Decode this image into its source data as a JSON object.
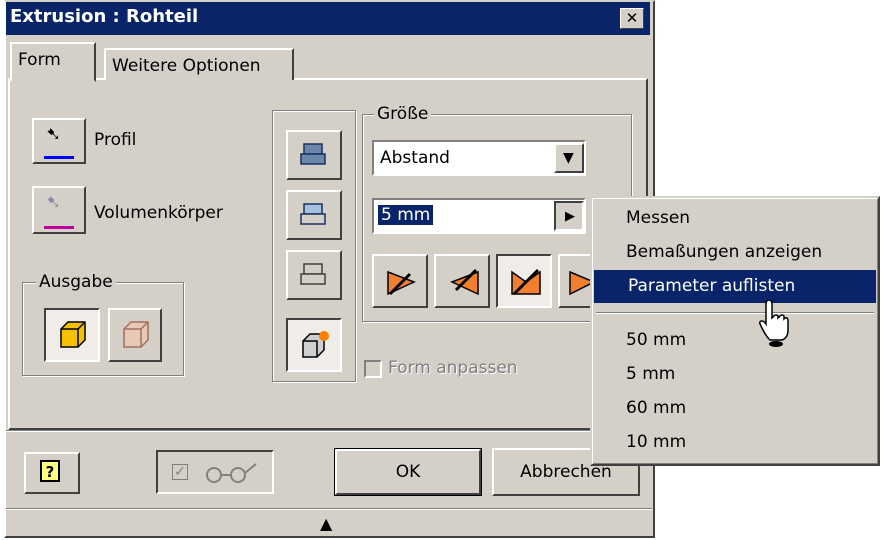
{
  "dialog": {
    "title": "Extrusion : Rohteil",
    "close_glyph": "✕",
    "tabs": [
      {
        "label": "Form"
      },
      {
        "label": "Weitere Optionen"
      }
    ]
  },
  "left": {
    "profil_label": "Profil",
    "volumen_label": "Volumenkörper",
    "ausgabe_label": "Ausgabe"
  },
  "groesse": {
    "legend": "Größe",
    "extents_value": "Abstand",
    "distance_value": "5 mm"
  },
  "form_anpassen_label": "Form anpassen",
  "buttons": {
    "ok": "OK",
    "abbrechen": "Abbrechen",
    "help_glyph": "?"
  },
  "context_menu": {
    "items": [
      "Messen",
      "Bemaßungen anzeigen",
      "Parameter auflisten"
    ],
    "recent_values": [
      "50 mm",
      "5 mm",
      "60 mm",
      "10 mm"
    ],
    "highlighted_index": 2
  },
  "colors": {
    "title_bar": "#0a246a",
    "highlight": "#0a246a",
    "face": "#d4d0c8",
    "profil_line": "#0000ff",
    "volumen_line": "#c000a0"
  }
}
